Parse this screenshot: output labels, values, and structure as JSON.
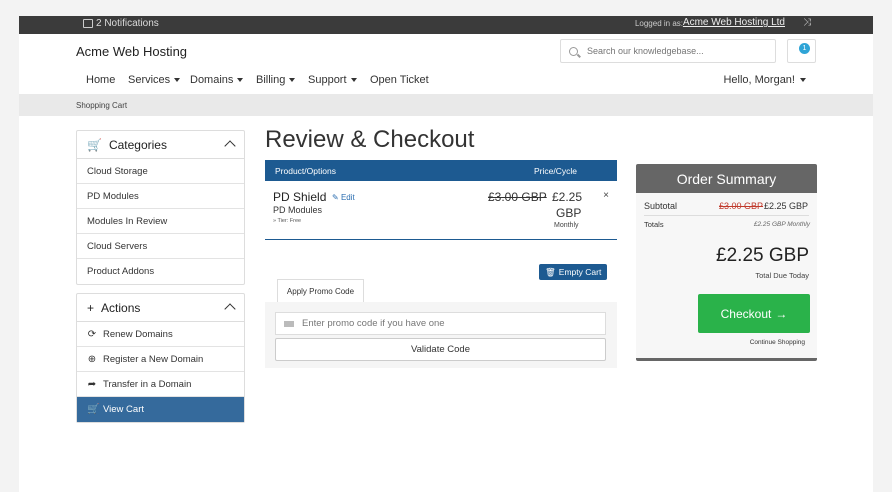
{
  "topbar": {
    "notifications": "2 Notifications",
    "logged_in_label": "Logged in as:",
    "account_name": "Acme Web Hosting Ltd"
  },
  "header": {
    "brand": "Acme Web Hosting",
    "search_placeholder": "Search our knowledgebase...",
    "cart_count": "1"
  },
  "nav": {
    "items": [
      {
        "label": "Home",
        "caret": false
      },
      {
        "label": "Services",
        "caret": true
      },
      {
        "label": "Domains",
        "caret": true
      },
      {
        "label": "Billing",
        "caret": true
      },
      {
        "label": "Support",
        "caret": true
      },
      {
        "label": "Open Ticket",
        "caret": false
      }
    ],
    "hello": "Hello, Morgan!"
  },
  "breadcrumb": "Shopping Cart",
  "sidebar": {
    "categories": {
      "title": "Categories",
      "items": [
        "Cloud Storage",
        "PD Modules",
        "Modules In Review",
        "Cloud Servers",
        "Product Addons"
      ]
    },
    "actions": {
      "title": "Actions",
      "items": [
        {
          "label": "Renew Domains",
          "icon": "refresh-icon"
        },
        {
          "label": "Register a New Domain",
          "icon": "globe-icon"
        },
        {
          "label": "Transfer in a Domain",
          "icon": "share-icon"
        },
        {
          "label": "View Cart",
          "icon": "cart-icon",
          "active": true
        }
      ]
    }
  },
  "main": {
    "title": "Review & Checkout",
    "table_head": {
      "product": "Product/Options",
      "price": "Price/Cycle"
    },
    "item": {
      "name": "PD Shield",
      "edit": "Edit",
      "group": "PD Modules",
      "tier": "» Tier: Free",
      "old_price": "£3.00 GBP",
      "new_price": "£2.25",
      "currency": "GBP",
      "cycle": "Monthly",
      "remove": "×"
    },
    "empty_cart": "Empty Cart",
    "promo": {
      "tab": "Apply Promo Code",
      "placeholder": "Enter promo code if you have one",
      "validate": "Validate Code"
    }
  },
  "summary": {
    "title": "Order Summary",
    "subtotal_label": "Subtotal",
    "subtotal_old": "£3.00 GBP",
    "subtotal_new": "£2.25 GBP",
    "totals_label": "Totals",
    "totals_value": "£2.25 GBP Monthly",
    "total": "£2.25 GBP",
    "total_due": "Total Due Today",
    "checkout": "Checkout",
    "continue": "Continue Shopping"
  },
  "colors": {
    "nav_blue": "#1d5a91",
    "active_blue": "#356a9c",
    "checkout_green": "#2ab24a",
    "summary_grey": "#666666",
    "badge_blue": "#2fa4d6"
  }
}
